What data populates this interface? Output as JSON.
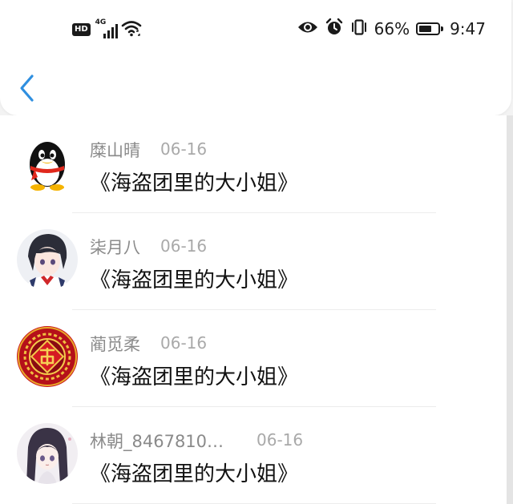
{
  "status_bar": {
    "hd_label": "HD",
    "network_label": "4G",
    "battery_percent": "66%",
    "battery_level": 0.66,
    "time": "9:47",
    "icons": [
      "hd-icon",
      "signal-icon",
      "wifi-icon",
      "eye-icon",
      "alarm-icon",
      "vibrate-icon",
      "battery-icon"
    ]
  },
  "header": {
    "back_icon": "chevron-left-icon"
  },
  "colors": {
    "accent": "#2f8fe0",
    "name_text": "#8a8a8a",
    "date_text": "#a9a9a9",
    "comment_text": "#111111"
  },
  "comments": [
    {
      "user": "糜山晴",
      "date": "06-16",
      "text": "《海盗团里的大小姐》",
      "avatar": "qq-penguin-avatar"
    },
    {
      "user": "柒月八",
      "date": "06-16",
      "text": "《海盗团里的大小姐》",
      "avatar": "anime-boy-avatar"
    },
    {
      "user": "蔺觅柔",
      "date": "06-16",
      "text": "《海盗团里的大小姐》",
      "avatar": "fortune-emblem-avatar"
    },
    {
      "user": "林朝_8467810…",
      "date": "06-16",
      "text": "《海盗团里的大小姐》",
      "avatar": "anime-girl-avatar"
    }
  ]
}
